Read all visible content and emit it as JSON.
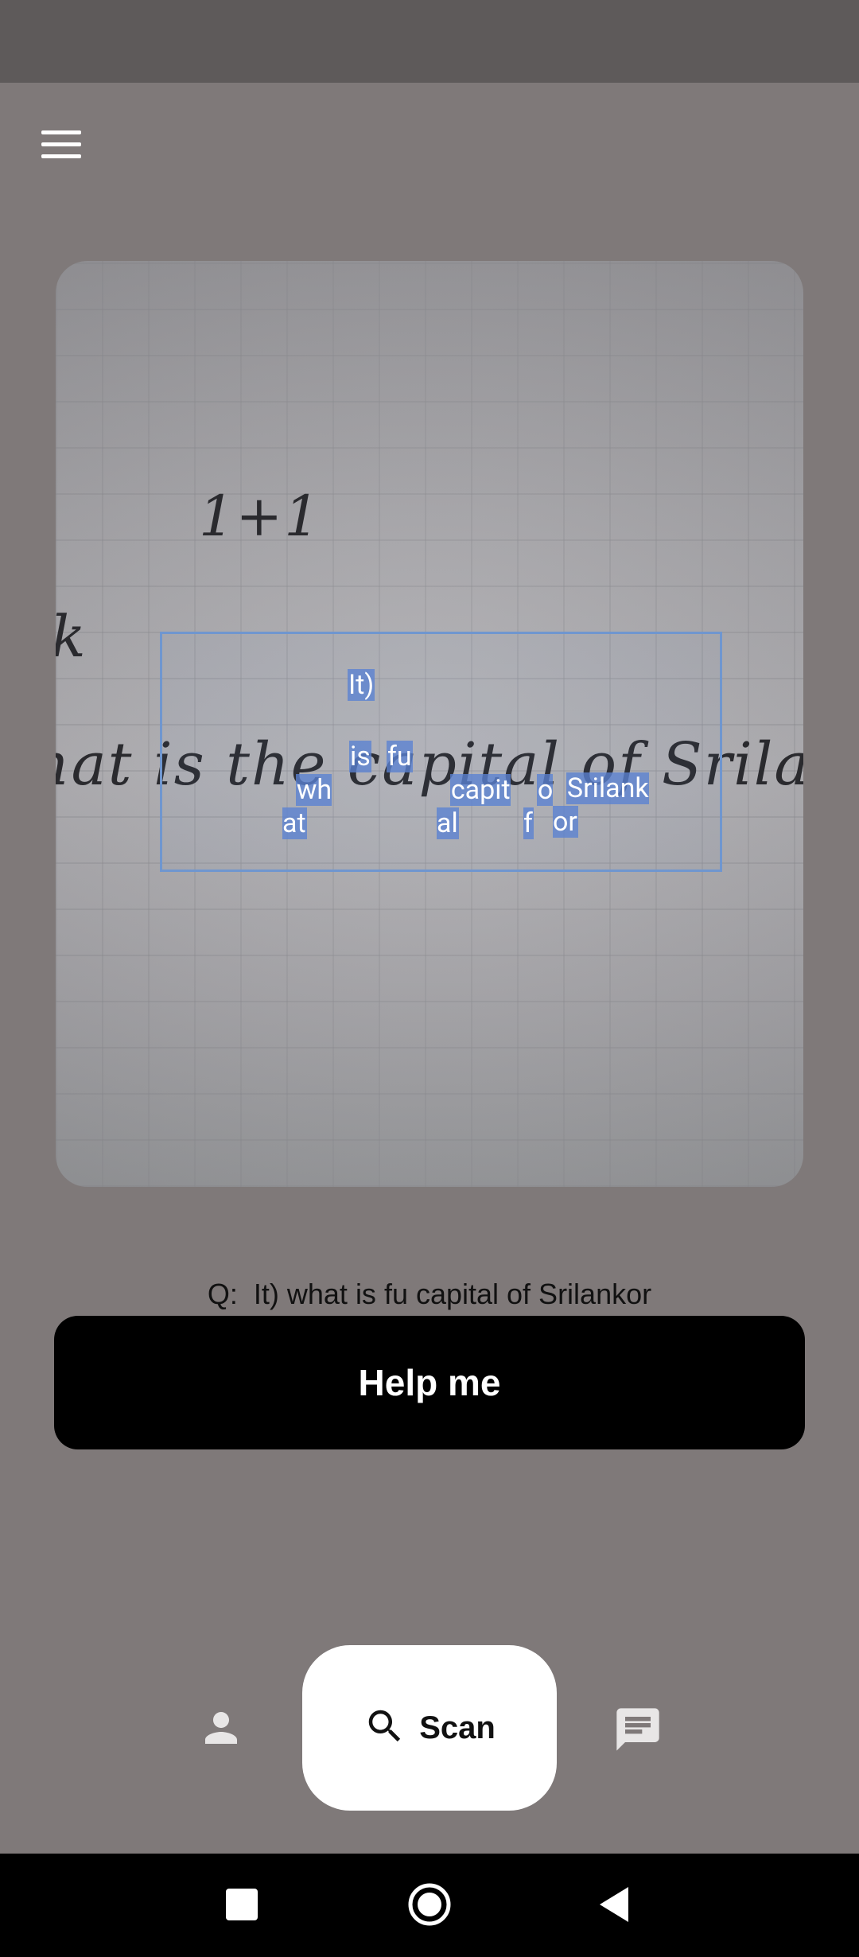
{
  "header": {
    "menu_icon": "hamburger-menu-icon"
  },
  "camera": {
    "handwritten": {
      "line_top": "1+1",
      "line_left_fragment": "k",
      "line_main": "hat is the capital of Srila"
    },
    "detected_words": [
      {
        "text": "It)"
      },
      {
        "text": "wh\nat"
      },
      {
        "text": "is"
      },
      {
        "text": "fu"
      },
      {
        "text": "capit\nal"
      },
      {
        "text": "o\nf"
      },
      {
        "text": "Srilank\nor"
      }
    ]
  },
  "question": {
    "text": "Q:  It) what is fu capital of Srilankor"
  },
  "help_button": {
    "label": "Help me"
  },
  "bottom_nav": {
    "profile_icon": "person-icon",
    "scan": {
      "label": "Scan",
      "icon": "search-icon"
    },
    "chat_icon": "chat-icon"
  },
  "system_nav": {
    "recents": "square-icon",
    "home": "circle-icon",
    "back": "triangle-back-icon"
  },
  "colors": {
    "highlight": "#5a82d2",
    "scan_box": "#6f96cf",
    "background": "#7f7979"
  }
}
